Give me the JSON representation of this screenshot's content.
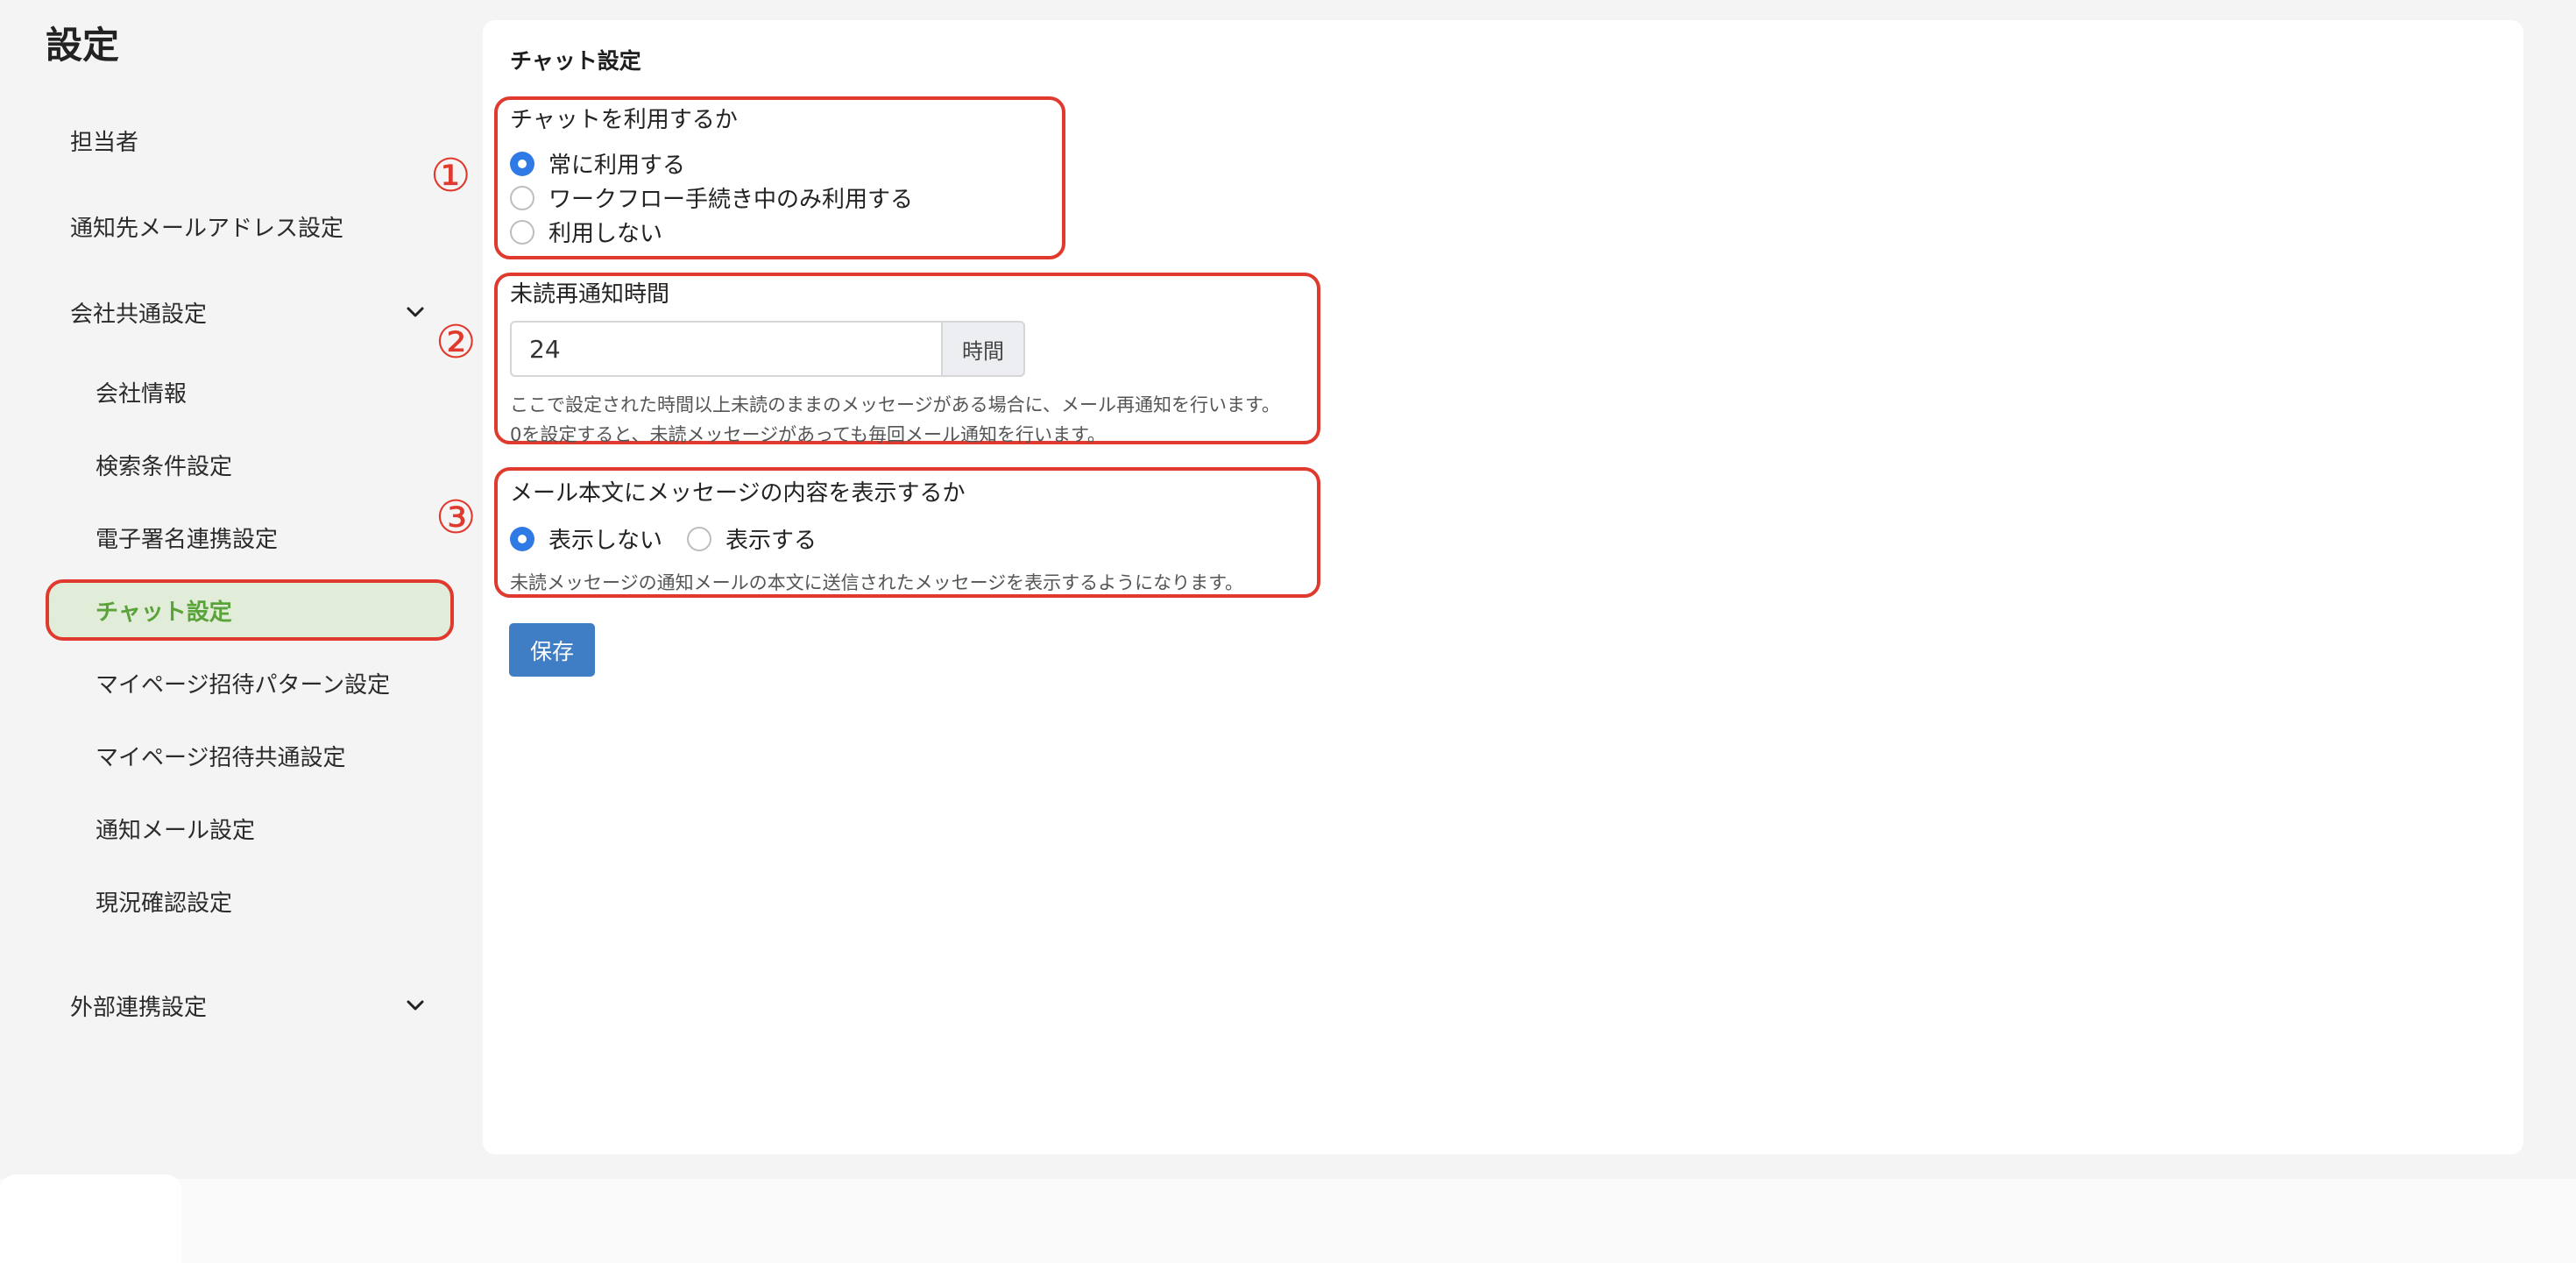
{
  "page_title": "設定",
  "sidebar": {
    "items": [
      {
        "label": "担当者"
      },
      {
        "label": "通知先メールアドレス設定"
      },
      {
        "label": "会社共通設定"
      },
      {
        "label": "会社情報"
      },
      {
        "label": "検索条件設定"
      },
      {
        "label": "電子署名連携設定"
      },
      {
        "label": "チャット設定"
      },
      {
        "label": "マイページ招待パターン設定"
      },
      {
        "label": "マイページ招待共通設定"
      },
      {
        "label": "通知メール設定"
      },
      {
        "label": "現況確認設定"
      },
      {
        "label": "外部連携設定"
      }
    ],
    "active_item": "チャット設定"
  },
  "main": {
    "section_title": "チャット設定",
    "use_chat": {
      "marker": "①",
      "label": "チャットを利用するか",
      "options": [
        "常に利用する",
        "ワークフロー手続き中のみ利用する",
        "利用しない"
      ],
      "selected": "常に利用する"
    },
    "renotify": {
      "marker": "②",
      "label": "未読再通知時間",
      "value": "24",
      "unit": "時間",
      "help_line1": "ここで設定された時間以上未読のままのメッセージがある場合に、メール再通知を行います。",
      "help_line2": "0を設定すると、未読メッセージがあっても毎回メール通知を行います。"
    },
    "show_content": {
      "marker": "③",
      "label": "メール本文にメッセージの内容を表示するか",
      "options": [
        "表示しない",
        "表示する"
      ],
      "selected": "表示しない",
      "help": "未読メッセージの通知メールの本文に送信されたメッセージを表示するようになります。"
    },
    "save_label": "保存"
  },
  "colors": {
    "highlight_border": "#e03a2e",
    "active_bg": "#e1ecd9",
    "active_text": "#5aa23a",
    "radio_checked": "#2f7ae5",
    "save_button": "#3f7dc4"
  }
}
